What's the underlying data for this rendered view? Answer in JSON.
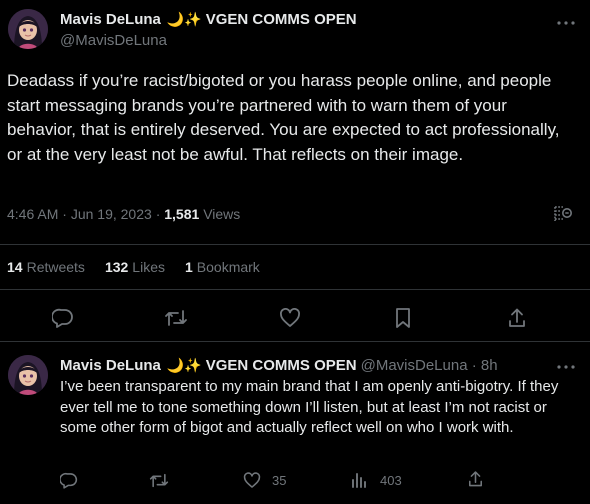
{
  "tweet": {
    "author_name": "Mavis DeLuna",
    "author_emoji": "🌙✨",
    "author_suffix": "VGEN COMMS OPEN",
    "handle": "@MavisDeLuna",
    "text": "Deadass if you’re racist/bigoted or you harass people online, and people start messaging brands you’re partnered with to warn them of your behavior, that is entirely deserved. You are expected to act professionally, or at the very least not be awful. That reflects on their image.",
    "time": "4:46 AM",
    "date": "Jun 19, 2023",
    "views_count": "1,581",
    "views_label": "Views",
    "retweets_count": "14",
    "retweets_label": "Retweets",
    "likes_count": "132",
    "likes_label": "Likes",
    "bookmarks_count": "1",
    "bookmarks_label": "Bookmark"
  },
  "reply": {
    "author_name": "Mavis DeLuna",
    "author_emoji": "🌙✨",
    "author_suffix": "VGEN COMMS OPEN",
    "handle": "@MavisDeLuna",
    "age": "8h",
    "text": "I’ve been transparent to my main brand that I am openly anti-bigotry. If they ever tell me to tone something down I’ll listen, but at least I’m not racist or some other form of bigot and actually reflect well on who I work with.",
    "likes": "35",
    "views": "403"
  },
  "icons": [
    "more-icon",
    "reply-icon",
    "retweet-icon",
    "like-icon",
    "bookmark-icon",
    "share-icon",
    "analytics-icon",
    "views-icon"
  ],
  "colors": {
    "background": "#000000",
    "text": "#e7e9ea",
    "muted": "#71767b",
    "divider": "#2f3336"
  }
}
